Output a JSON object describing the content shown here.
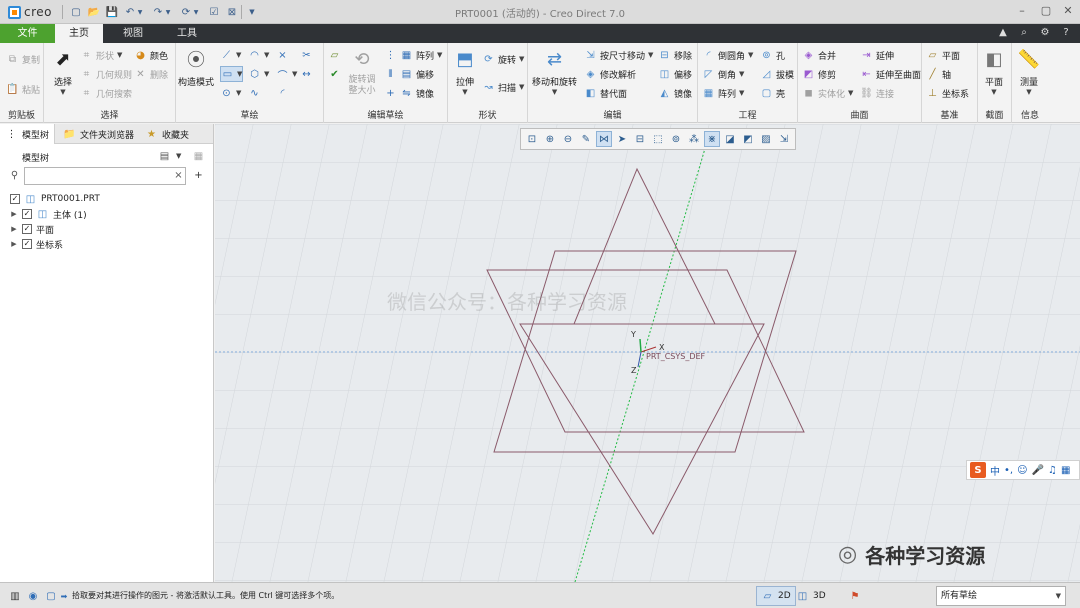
{
  "app": {
    "logo_text": "creo",
    "window_title": "PRT0001 (活动的) - Creo Direct 7.0"
  },
  "quick_access": [
    "new-icon",
    "open-icon",
    "save-icon",
    "undo-icon",
    "redo-icon",
    "regenerate-icon",
    "windows-icon",
    "close-window-icon",
    "customize-icon"
  ],
  "tabs": {
    "file": "文件",
    "home": "主页",
    "view": "视图",
    "tools": "工具"
  },
  "ribbon": {
    "clipboard": {
      "label": "剪贴板",
      "copy": "复制",
      "paste": "粘贴"
    },
    "select": {
      "label": "选择",
      "select_btn": "选择",
      "shape": "形状",
      "geometry_rules": "几何规则",
      "geometry_search": "几何搜索",
      "color": "颜色",
      "delete": "删除"
    },
    "sketch": {
      "label": "草绘",
      "construction_mode": "构造模式"
    },
    "edit_sketch": {
      "label": "编辑草绘",
      "rotate_resize": "旋转调整大小",
      "array": "阵列",
      "offset": "偏移",
      "mirror": "镜像"
    },
    "shapes": {
      "label": "形状",
      "extrude": "拉伸",
      "revolve": "旋转",
      "sweep": "扫描"
    },
    "edit": {
      "label": "编辑",
      "move_rotate": "移动和旋转",
      "move_by_dim": "按尺寸移动",
      "modify_analysis": "修改解析",
      "replace": "替代面",
      "remove": "移除",
      "offset": "偏移",
      "mirror": "镜像"
    },
    "engineering": {
      "label": "工程",
      "round": "倒圆角",
      "chamfer": "倒角",
      "pattern": "阵列",
      "hole": "孔",
      "draft": "拔模",
      "shell": "壳"
    },
    "surfaces": {
      "label": "曲面",
      "merge": "合并",
      "trim": "修剪",
      "solidify": "实体化",
      "extend": "延伸",
      "extend_to_surface": "延伸至曲面",
      "connect": "连接"
    },
    "datum": {
      "label": "基准",
      "plane": "平面",
      "axis": "轴",
      "csys": "坐标系"
    },
    "section": {
      "label": "截面",
      "plane": "平面"
    },
    "info": {
      "label": "信息",
      "measure": "测量"
    }
  },
  "left_panel": {
    "tabs": {
      "model_tree": "模型树",
      "folder_browser": "文件夹浏览器",
      "favorites": "收藏夹"
    },
    "header": "模型树",
    "filter_placeholder": "",
    "tree": [
      {
        "label": "PRT0001.PRT",
        "checked": true
      },
      {
        "label": "主体 (1)",
        "checked": true
      },
      {
        "label": "平面",
        "checked": true
      },
      {
        "label": "坐标系",
        "checked": true
      }
    ]
  },
  "viewport": {
    "view_toolbar": [
      "refit-icon",
      "zoom-in-icon",
      "zoom-out-icon",
      "repaint-icon",
      "display-style-icon",
      "saved-orientations-icon",
      "view-manager-icon",
      "perspective-icon",
      "datum-display-icon",
      "annotation-display-icon",
      "spin-center-icon",
      "section-icon",
      "appearance-icon"
    ],
    "csys_label": "PRT_CSYS_DEF",
    "axis_x": "X",
    "axis_y": "Y",
    "axis_z": "Z",
    "watermark": "微信公众号：各种学习资源",
    "colors": {
      "datum_plane": "#8a5a6a",
      "grid": "#d0d4d8",
      "axis_line": "#22bb44"
    }
  },
  "ime": {
    "logo": "S",
    "label": "中"
  },
  "watermark_bottom": "各种学习资源",
  "status_bar": {
    "message": "拾取要对其进行操作的图元 - 将激活默认工具。使用 Ctrl 键可选择多个项。",
    "mode_2d": "2D",
    "mode_3d": "3D",
    "filter_value": "所有草绘"
  }
}
